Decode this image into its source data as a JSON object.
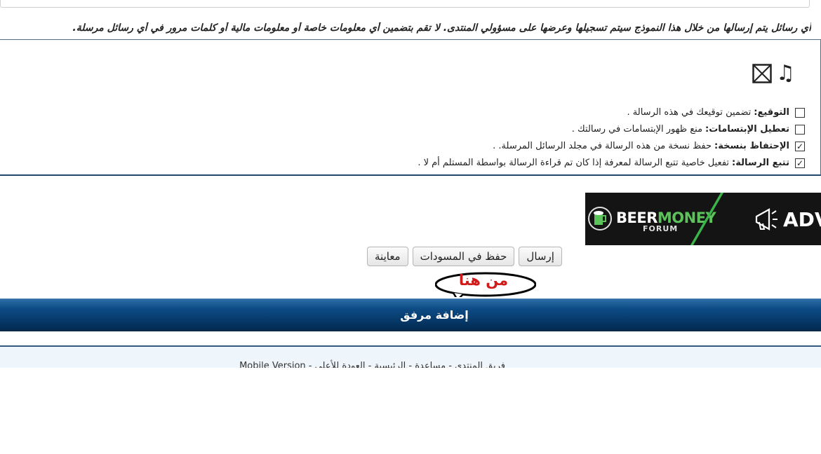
{
  "warning": "أي رسائل يتم إرسالها من خلال هذا النموذج سيتم تسجيلها وعرضها على مسؤولي المنتدى. لا تقم بتضمين أي معلومات خاصة أو معلومات مالية أو كلمات مرور في أي رسائل مرسلة.",
  "options": [
    {
      "label": "التوقيع:",
      "desc": "تضمين توقيعك في هذه الرسالة .",
      "checked": false,
      "mark": ""
    },
    {
      "label": "تعطيل الإبتسامات:",
      "desc": "منع ظهور الإبتسامات في رسالتك .",
      "checked": false,
      "mark": ""
    },
    {
      "label": "الإحتفاظ بنسخة:",
      "desc": "حفظ نسخة من هذه الرسالة في مجلد الرسائل المرسلة. .",
      "checked": true,
      "mark": "✓"
    },
    {
      "label": "تتبع الرسالة:",
      "desc": "تفعيل خاصية تتبع الرسالة لمعرفة إذا كان تم قراءة الرسالة بواسطة المستلم أم لا .",
      "checked": true,
      "mark": "✓"
    }
  ],
  "icons": {
    "box": "checkbox-x-icon",
    "note": "♫",
    "note_name": "music-note-icon"
  },
  "banner": {
    "beer": "BEER",
    "money": "MONEY",
    "forum": "FORUM",
    "adv": "ADVE"
  },
  "buttons": {
    "send": "إرسال",
    "save_draft": "حفظ في المسودات",
    "preview": "معاينة"
  },
  "annotation": "من هنا",
  "attach_label": "إضافة مرفق",
  "footer_text": "فريق المنتدى - مساعدة - الرئيسية - العودة للأعلى - Mobile Version",
  "colors": {
    "bar_top": "#2d6da6",
    "bar_bottom": "#022a52",
    "annotation": "#d11a1a",
    "banner_green": "#3bb54a"
  }
}
